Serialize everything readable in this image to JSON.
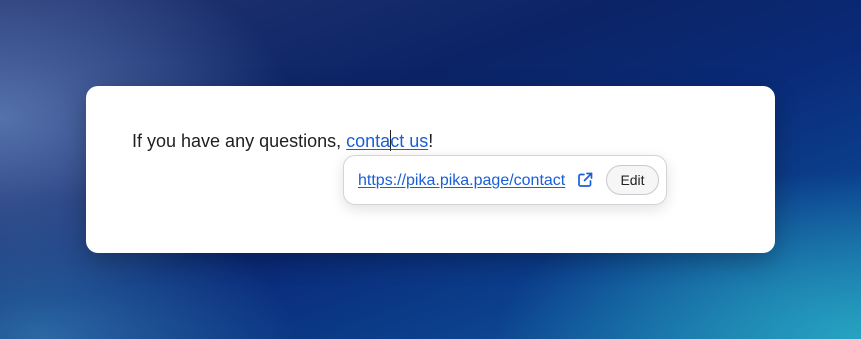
{
  "editor": {
    "text_before": "If you have any questions, ",
    "link_text_before_caret": "conta",
    "link_text_after_caret": "ct us",
    "text_after": "!"
  },
  "link_popover": {
    "url": "https://pika.pika.page/contact",
    "open_icon": "external-link-icon",
    "edit_label": "Edit"
  },
  "colors": {
    "link": "#1a5fd6",
    "text": "#1f1f1f"
  }
}
